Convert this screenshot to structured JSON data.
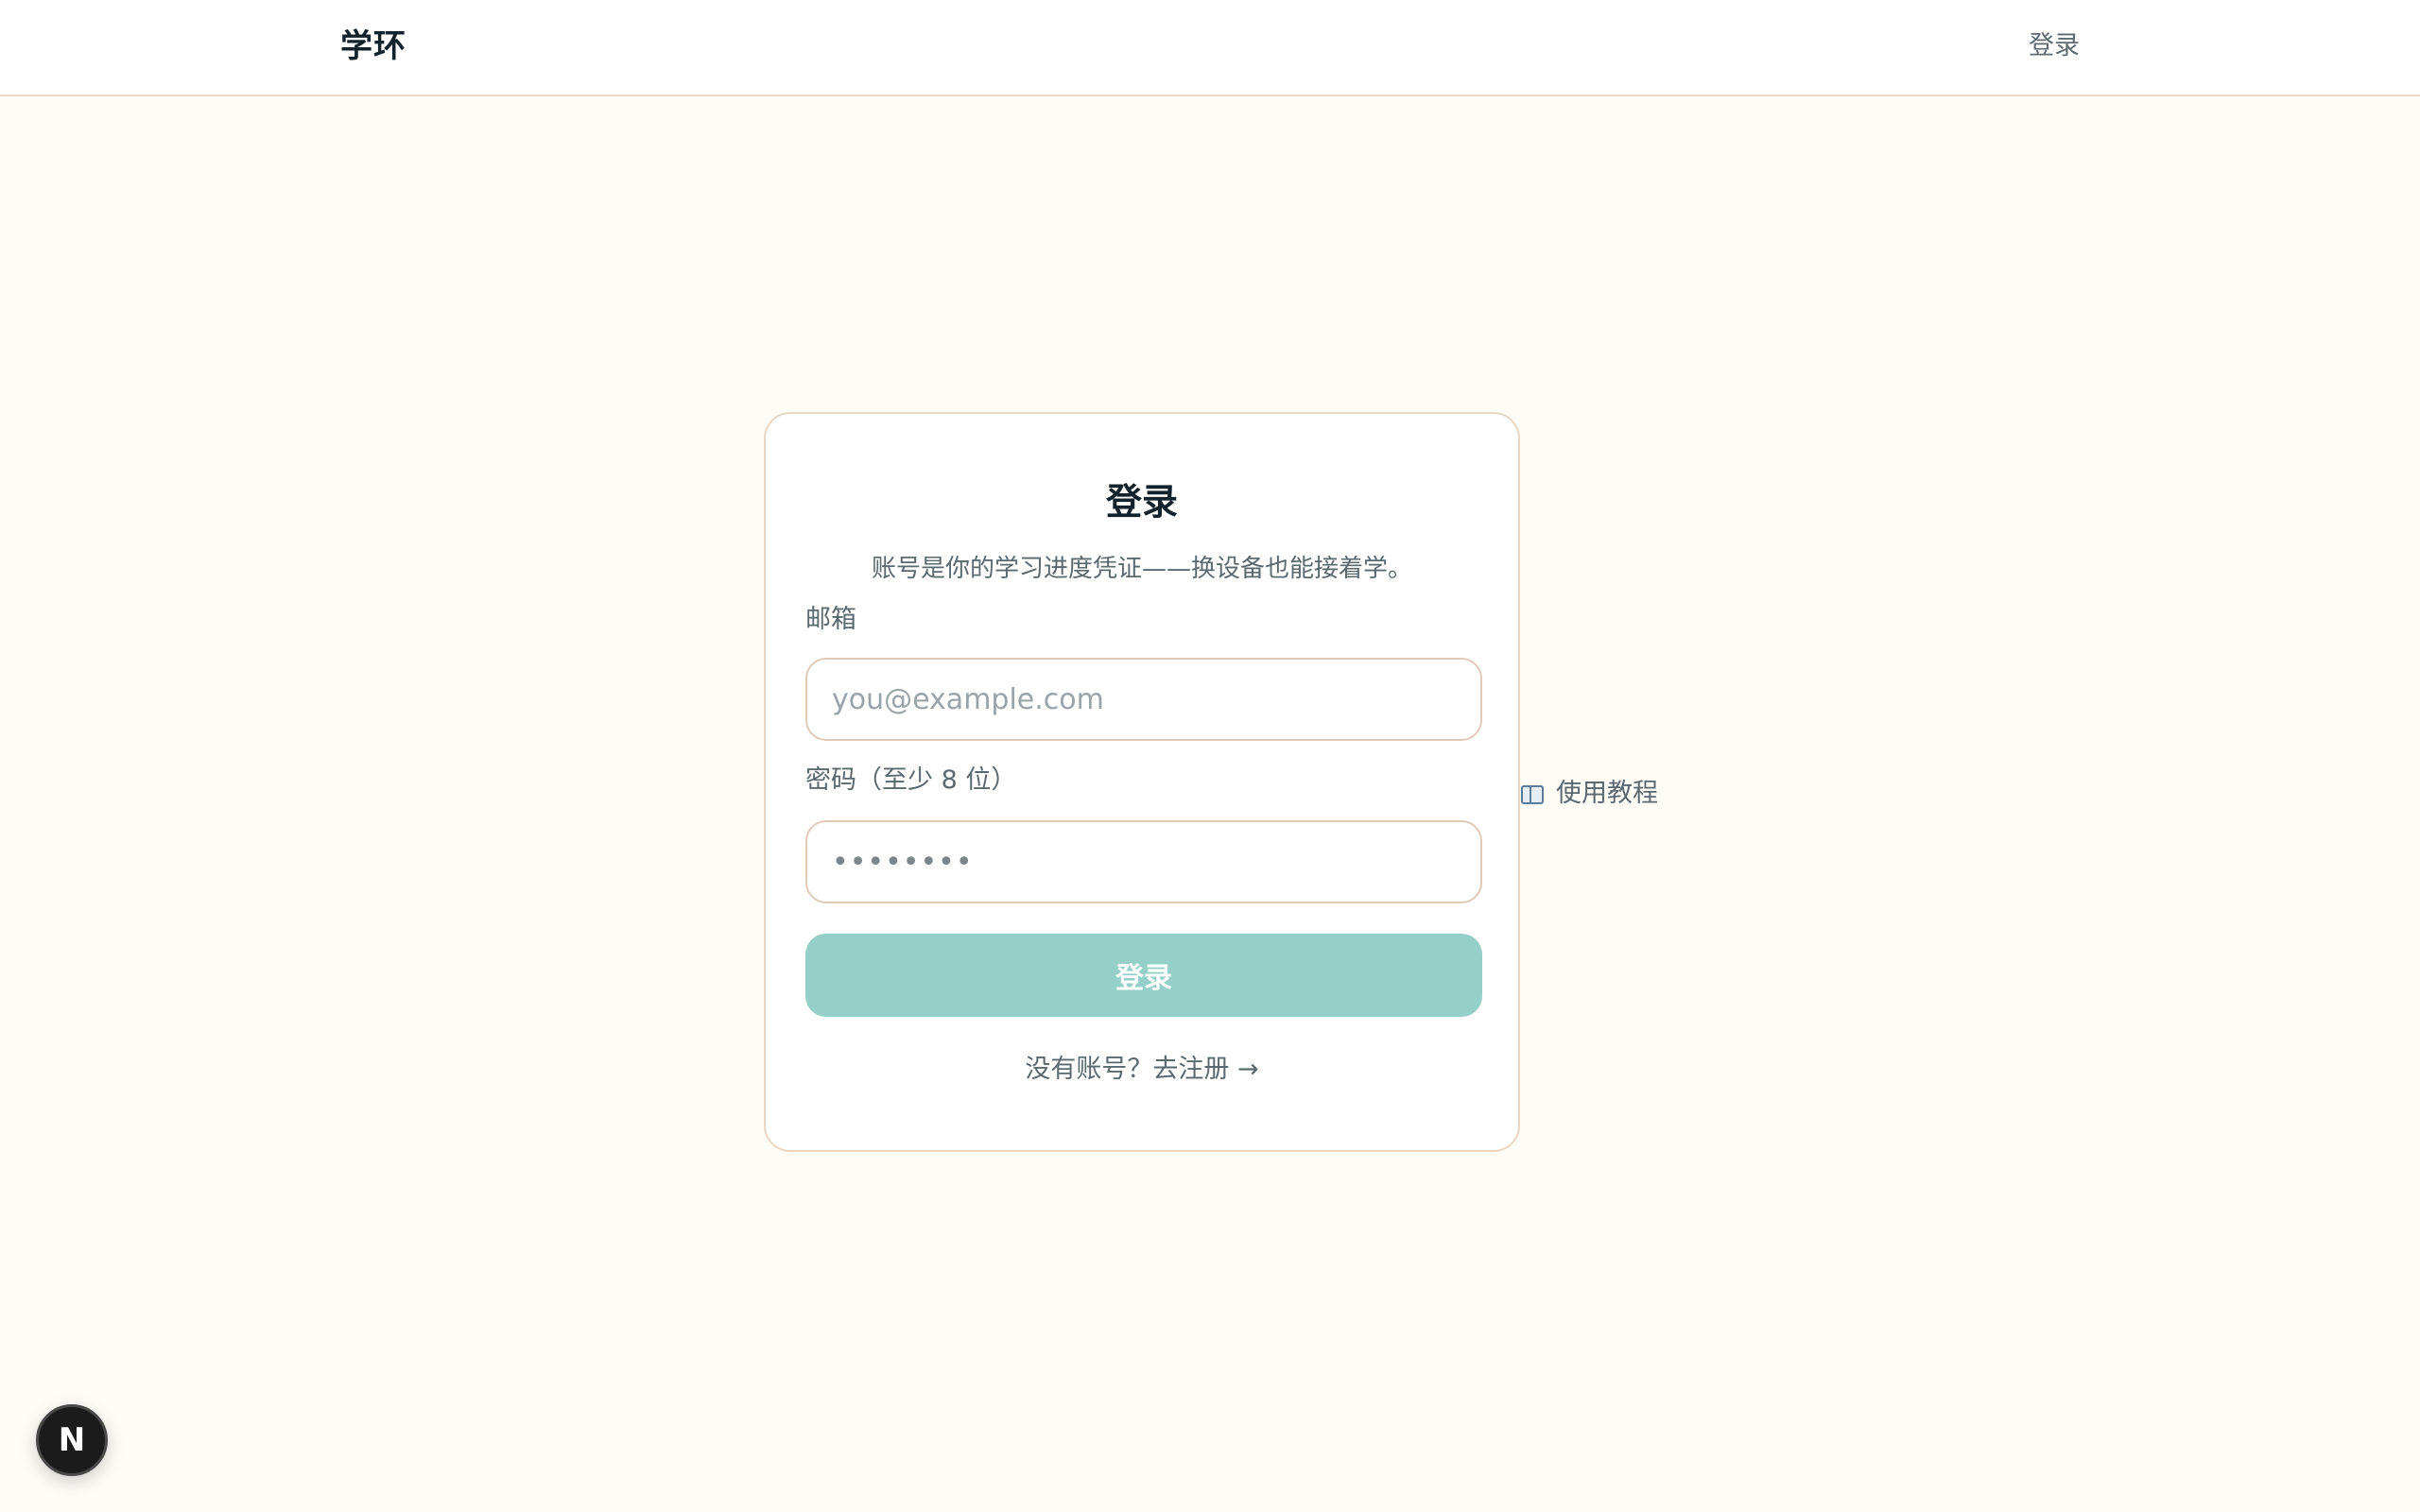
{
  "header": {
    "brand": "学环",
    "login_link": "登录"
  },
  "login_card": {
    "title": "登录",
    "subtitle": "账号是你的学习进度凭证——换设备也能接着学。",
    "email": {
      "label": "邮箱",
      "placeholder": "you@example.com",
      "value": ""
    },
    "password": {
      "label": "密码（至少 8 位）",
      "value": "••••••••"
    },
    "submit_label": "登录",
    "register_link": "没有账号？去注册 →"
  },
  "tutorial": {
    "icon": "book-icon",
    "label": "使用教程"
  },
  "dev_tools": {
    "label": "N"
  },
  "colors": {
    "background": "#fdfcf7",
    "accent_button": "#94cfc8",
    "card_border": "#e8d6c4",
    "text_primary": "#14232b",
    "text_muted": "#5b686e"
  }
}
